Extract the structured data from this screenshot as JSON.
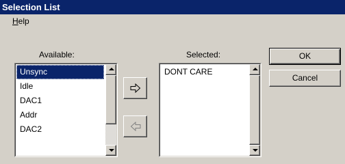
{
  "window": {
    "title": "Selection List"
  },
  "menu": {
    "help_prefix": "",
    "help_accel": "H",
    "help_rest": "elp"
  },
  "available": {
    "label": "Available:",
    "items": [
      "Unsync",
      "Idle",
      "DAC1",
      "Addr",
      "DAC2"
    ],
    "selected_index": 0
  },
  "selected": {
    "label": "Selected:",
    "items": [
      "DONT CARE"
    ]
  },
  "buttons": {
    "ok": "OK",
    "cancel": "Cancel"
  },
  "icons": {
    "add": "arrow-right-outline-icon",
    "remove": "arrow-left-outline-icon",
    "scroll_up": "triangle-up-icon",
    "scroll_down": "triangle-down-icon"
  },
  "colors": {
    "titlebar": "#0a246a",
    "face": "#d4d0c8",
    "selection": "#0a246a"
  }
}
